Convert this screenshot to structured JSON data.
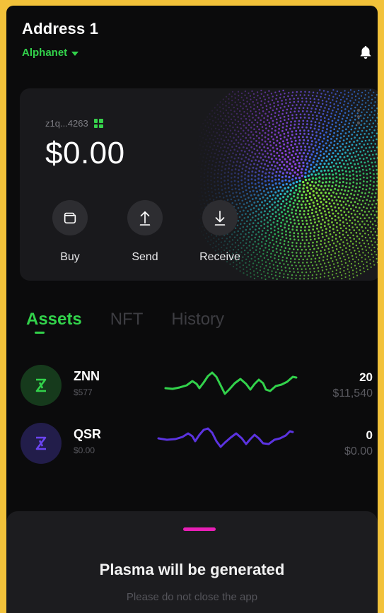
{
  "header": {
    "address_title": "Address 1",
    "network": "Alphanet"
  },
  "wallet_card": {
    "short_address": "z1q...4263",
    "balance": "$0.00",
    "actions": [
      {
        "label": "Buy",
        "icon": "wallet-icon"
      },
      {
        "label": "Send",
        "icon": "arrow-up-icon"
      },
      {
        "label": "Receive",
        "icon": "arrow-down-icon"
      }
    ]
  },
  "tabs": [
    {
      "label": "Assets",
      "active": true
    },
    {
      "label": "NFT",
      "active": false
    },
    {
      "label": "History",
      "active": false
    }
  ],
  "assets": [
    {
      "symbol": "ZNN",
      "price": "$577",
      "amount": "20",
      "value": "$11,540",
      "color": "#32d24b",
      "icon_bg": "#163a1c"
    },
    {
      "symbol": "QSR",
      "price": "$0.00",
      "amount": "0",
      "value": "$0.00",
      "color": "#5b33e0",
      "icon_bg": "#221d4a"
    }
  ],
  "plasma_sheet": {
    "title": "Plasma will be generated",
    "subtitle": "Please do not close the app"
  },
  "colors": {
    "accent_green": "#32d24b",
    "accent_purple": "#5b33e0",
    "handle_pink": "#e81fb6",
    "background": "#0b0b0c",
    "frame": "#f2c23a"
  }
}
